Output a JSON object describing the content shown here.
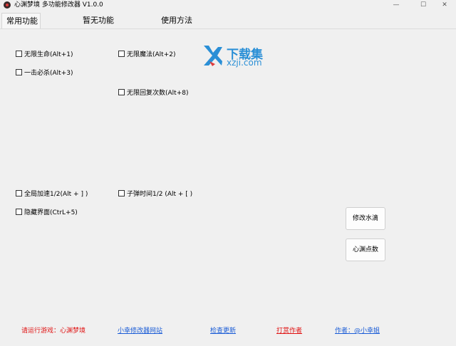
{
  "window": {
    "title": "心渊梦境 多功能修改器  V1.0.0",
    "min_glyph": "—",
    "max_glyph": "☐",
    "close_glyph": "✕"
  },
  "tabs": [
    {
      "label": "常用功能",
      "active": true
    },
    {
      "label": "暂无功能",
      "active": false
    },
    {
      "label": "使用方法",
      "active": false
    }
  ],
  "options": {
    "infinite_life": "无限生命(Alt+1)",
    "infinite_magic": "无限魔法(Alt+2)",
    "one_hit_kill": "一击必杀(Alt+3)",
    "infinite_restore": "无限回复次数(Alt+8)",
    "global_speed": "全局加速1/2(Alt + ] )",
    "bullet_time": "子弹时间1/2 (Alt + [ )",
    "hide_ui": "隐藏界面(CtrL+5)"
  },
  "buttons": {
    "modify_water": "修改水滴",
    "abyss_points": "心渊点数"
  },
  "status": {
    "run_game": "请运行游戏：心渊梦境",
    "site_link": "小幸修改器网站",
    "check_update": "检查更新",
    "donate": "打赏作者",
    "author": "作者：@小幸姐"
  },
  "watermark": {
    "cn": "下载集",
    "en": "xzji.com"
  },
  "colors": {
    "link": "#1a5cd6",
    "red": "#e01414",
    "watermark": "#2a8fd6"
  }
}
